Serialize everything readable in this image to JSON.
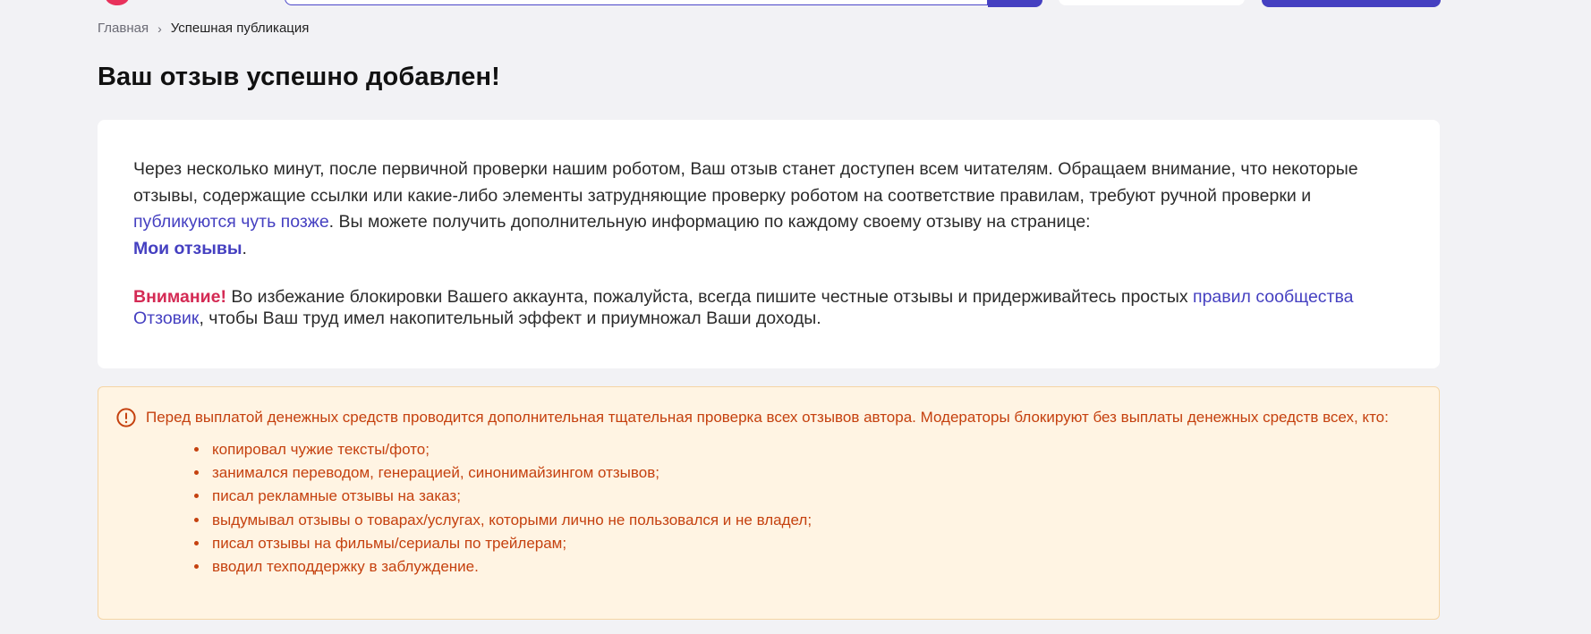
{
  "header": {
    "search_placeholder": ""
  },
  "breadcrumb": {
    "home": "Главная",
    "separator": "›",
    "current": "Успешная публикация"
  },
  "page_title": "Ваш отзыв успешно добавлен!",
  "info_card": {
    "paragraph1_part1": "Через несколько минут, после первичной проверки нашим роботом, Ваш отзыв станет доступен всем читателям. Обращаем внимание, что некоторые отзывы, содержащие ссылки или какие-либо элементы затрудняющие проверку роботом на соответствие правилам, требуют ручной проверки и ",
    "later_link": "публикуются чуть позже",
    "paragraph1_part2": ". Вы можете получить дополнительную информацию по каждому своему отзыву на странице: ",
    "my_reviews_link": "Мои отзывы",
    "paragraph1_end": ".",
    "attention_label": "Внимание!",
    "paragraph2_part1": " Во избежание блокировки Вашего аккаунта, пожалуйста, всегда пишите честные отзывы и придерживайтесь простых ",
    "rules_link": "правил сообщества Отзовик",
    "paragraph2_part2": ", чтобы Ваш труд имел накопительный эффект и приумножал Ваши доходы."
  },
  "notice": {
    "icon": "exclamation-circle-icon",
    "text": "Перед выплатой денежных средств проводится дополнительная тщательная проверка всех отзывов автора. Модераторы блокируют без выплаты денежных средств всех, кто:",
    "items": [
      "копировал чужие тексты/фото;",
      "занимался переводом, генерацией, синонимайзингом отзывов;",
      "писал рекламные отзывы на заказ;",
      "выдумывал отзывы о товарах/услугах, которыми лично не пользовался и не владел;",
      "писал отзывы на фильмы/сериалы по трейлерам;",
      "вводил техподдержку в заблуждение."
    ]
  },
  "colors": {
    "accent": "#4540c1",
    "attention": "#d42a54",
    "notice_text": "#c5410f",
    "notice_bg": "#fff4e3",
    "page_bg": "#f2f2f5"
  }
}
